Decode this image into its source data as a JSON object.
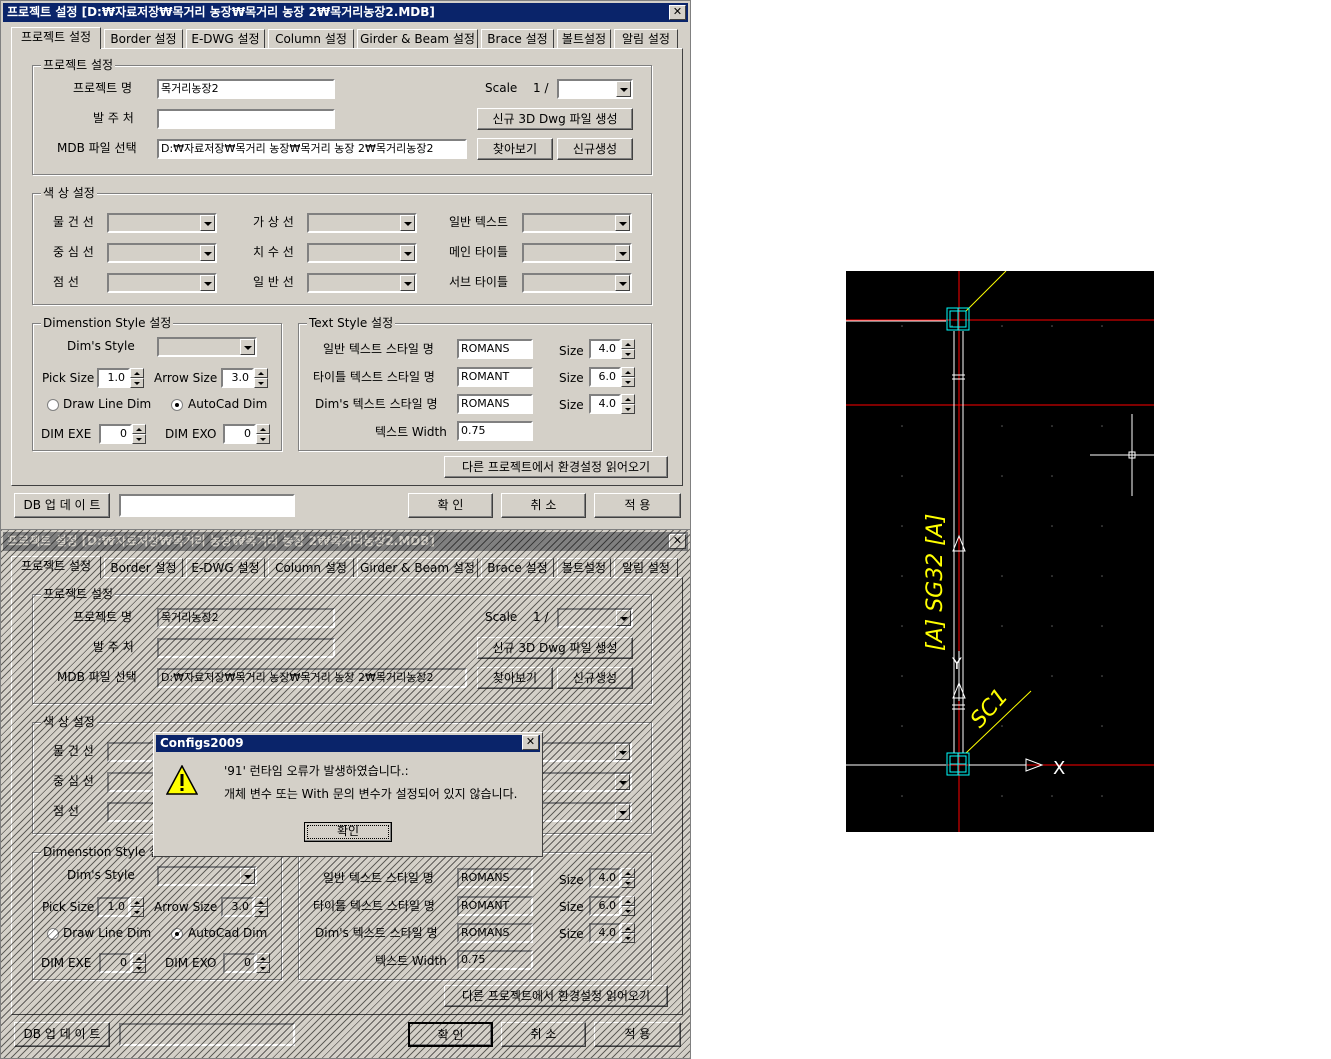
{
  "window": {
    "title": "프로젝트 설정  [D:₩자료저장₩목거리 농장₩목거리 농장 2₩목거리농장2.MDB]",
    "close": "✕"
  },
  "tabs": [
    "프로젝트 설정",
    "Border 설정",
    "E-DWG 설정",
    "Column 설정",
    "Girder & Beam 설정",
    "Brace 설정",
    "볼트설정",
    "알림 설정"
  ],
  "project": {
    "group_title": "프로젝트 설정",
    "name_label": "프로젝트 명",
    "name_value": "목거리농장2",
    "client_label": "발 주 처",
    "client_value": "",
    "mdb_label": "MDB 파일 선택",
    "mdb_value": "D:₩자료저장₩목거리 농장₩목거리 농장 2₩목거리농장2",
    "scale_label": "Scale",
    "scale_prefix": "1 /",
    "new3d_button": "신규 3D Dwg 파일 생성",
    "browse_button": "찾아보기",
    "new_button": "신규생성"
  },
  "color": {
    "group_title": "색 상 설정",
    "labels": [
      "물 건 선",
      "중 심 선",
      "점      선",
      "가 상 선",
      "치 수 선",
      "일 반 선",
      "일반 텍스트",
      "메인 타이틀",
      "서브 타이틀"
    ]
  },
  "dim": {
    "group_title": "Dimenstion Style 설정",
    "style_label": "Dim's Style",
    "pick_label": "Pick Size",
    "pick_value": "1.0",
    "arrow_label": "Arrow Size",
    "arrow_value": "3.0",
    "draw_line_label": "Draw Line Dim",
    "autocad_label": "AutoCad Dim",
    "exe_label": "DIM EXE",
    "exe_value": "0",
    "exo_label": "DIM EXO",
    "exo_value": "0"
  },
  "text": {
    "group_title": "Text Style 설정",
    "rows": [
      {
        "label": "일반 텍스트 스타일 명",
        "value": "ROMANS",
        "size": "4.0"
      },
      {
        "label": "타이틀 텍스트 스타일 명",
        "value": "ROMANT",
        "size": "6.0"
      },
      {
        "label": "Dim's 텍스트 스타일 명",
        "value": "ROMANS",
        "size": "4.0"
      }
    ],
    "size_label": "Size",
    "width_label": "텍스트 Width",
    "width_value": "0.75"
  },
  "load_other_button": "다른 프로젝트에서 환경설정 읽어오기",
  "footer": {
    "db_update": "DB 업 데 이 트",
    "ok": "확   인",
    "cancel": "취   소",
    "apply": "적   용"
  },
  "dialog": {
    "title": "Configs2009",
    "close": "✕",
    "line1": "'91' 런타임 오류가 발생하였습니다.:",
    "line2": "개체 변수 또는 With 문의 변수가 설정되어 있지 않습니다.",
    "ok": "확인",
    "icon": "warning-icon"
  },
  "cad": {
    "labels": [
      "[A] SG32 [A]",
      "SC1",
      "X",
      "Y"
    ],
    "colors": {
      "grid_line": "#ff0000",
      "member": "#ffffff",
      "column": "#00ffff",
      "text": "#ffff00",
      "background": "#000000"
    }
  }
}
